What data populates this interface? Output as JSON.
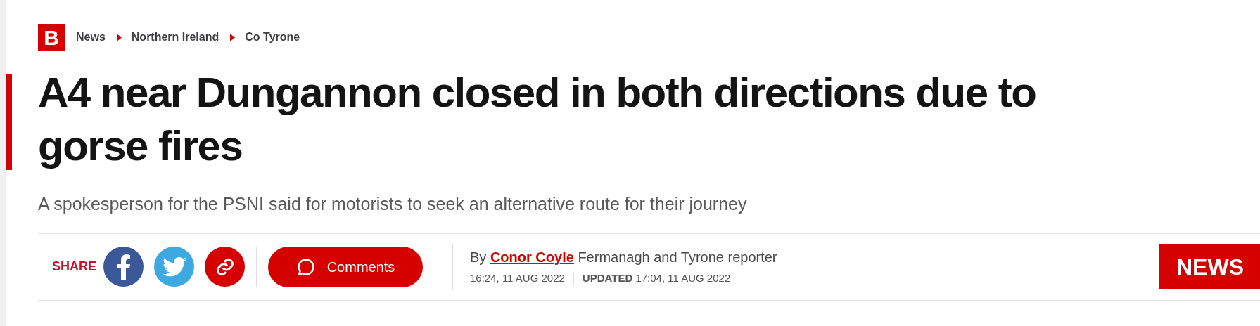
{
  "logo": {
    "letter": "B"
  },
  "breadcrumbs": [
    {
      "label": "News"
    },
    {
      "label": "Northern Ireland"
    },
    {
      "label": "Co Tyrone"
    }
  ],
  "headline": "A4 near Dungannon closed in both directions due to gorse fires",
  "standfirst": "A spokesperson for the PSNI said for motorists to seek an alternative route for their journey",
  "share": {
    "label": "SHARE",
    "buttons": [
      {
        "kind": "facebook"
      },
      {
        "kind": "twitter"
      },
      {
        "kind": "link"
      }
    ]
  },
  "comments_button": "Comments",
  "byline": {
    "prefix": "By",
    "author": "Conor Coyle",
    "role": "Fermanagh and Tyrone reporter"
  },
  "published": "16:24, 11 AUG 2022",
  "updated": "**UPDATED** 17:04, 11 AUG 2022",
  "section_badge": "NEWS"
}
